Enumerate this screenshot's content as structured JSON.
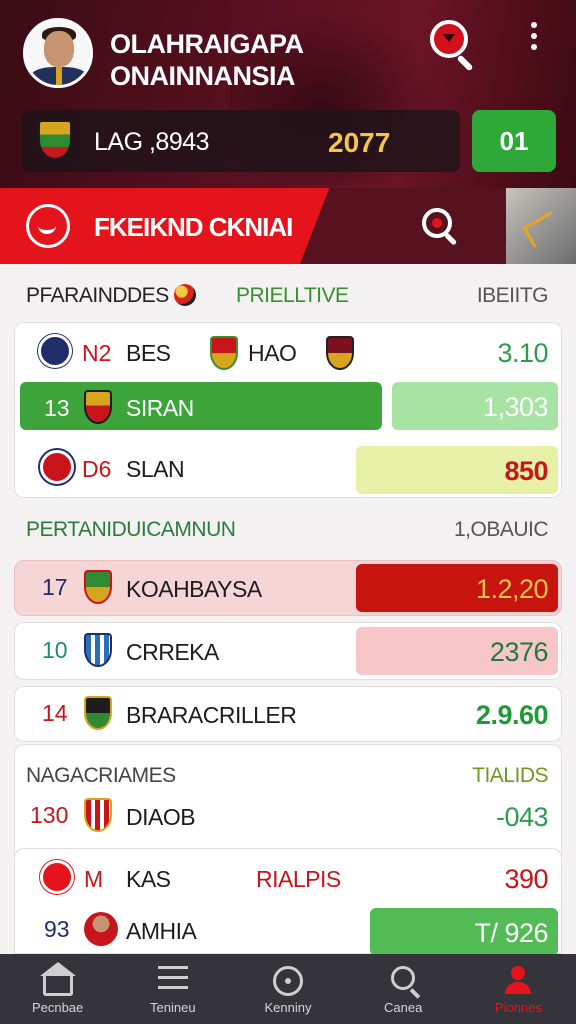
{
  "header": {
    "title_line1": "OLAHRAIGAPA",
    "title_line2": "ONAINNANSIA",
    "live_code": "LAG ,8943",
    "live_year": "2077",
    "live_button": "01"
  },
  "banner": {
    "title": "FKEIKND CKNIAI"
  },
  "standings": {
    "section1": {
      "left": "PFARAINDDES",
      "middle": "PRIELLTIVE",
      "right": "IBEIITG"
    },
    "row1": {
      "rank": "N2",
      "team_a": "BES",
      "team_b": "HAO",
      "value": "3.10"
    },
    "row2": {
      "rank": "13",
      "team": "SIRAN",
      "value": "1,303"
    },
    "row3": {
      "rank": "D6",
      "team": "SLAN",
      "value": "850"
    },
    "section2": {
      "left": "PERTANIDUICAMNUN",
      "right": "1,OBAUIC"
    },
    "row4": {
      "rank": "17",
      "team": "KOAHBAYSA",
      "value": "1.2,20"
    },
    "row5": {
      "rank": "10",
      "team": "CRREKA",
      "value": "2376"
    },
    "row6": {
      "rank": "14",
      "team": "BRARACRILLER",
      "value": "2.9.60"
    },
    "section3": {
      "left": "NAGACRIAMES",
      "right": "TIALIDS"
    },
    "row7": {
      "rank": "130",
      "team": "DIAOB",
      "value": "-043"
    },
    "row8": {
      "rank": "M",
      "team": "KAS",
      "tag": "RIALPIS",
      "value": "390"
    },
    "row9": {
      "rank": "93",
      "team": "AMHIA",
      "value": "T/ 926"
    }
  },
  "nav": {
    "items": [
      {
        "label": "Pecnbae",
        "icon": "home-icon"
      },
      {
        "label": "Tenineu",
        "icon": "list-icon"
      },
      {
        "label": "Kenniny",
        "icon": "target-icon"
      },
      {
        "label": "Canea",
        "icon": "search-icon"
      },
      {
        "label": "Pionnes",
        "icon": "profile-icon"
      }
    ]
  },
  "colors": {
    "brand_red": "#e5131c",
    "header_maroon": "#5a1020",
    "live_green": "#2fa83a",
    "text_green": "#1e9a36",
    "text_red": "#c8141b",
    "text_navy": "#1f2d6b",
    "nav_bg": "#34343a"
  }
}
